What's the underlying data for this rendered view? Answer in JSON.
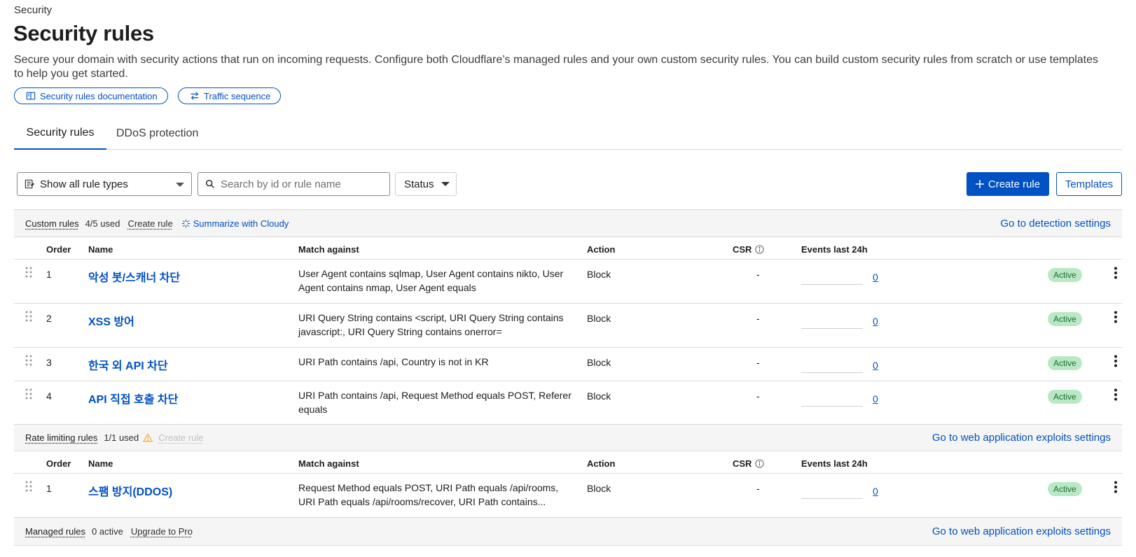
{
  "breadcrumb": "Security",
  "page_title": "Security rules",
  "description": "Secure your domain with security actions that run on incoming requests. Configure both Cloudflare’s managed rules and your own custom security rules. You can build custom security rules from scratch or use templates to help you get started.",
  "doc_links": [
    {
      "label": "Security rules documentation",
      "icon": "book-icon"
    },
    {
      "label": "Traffic sequence",
      "icon": "arrows-exchange-icon"
    }
  ],
  "tabs": [
    {
      "label": "Security rules",
      "active": true
    },
    {
      "label": "DDoS protection",
      "active": false
    }
  ],
  "toolbar": {
    "rule_type_select": "Show all rule types",
    "search_placeholder": "Search by id or rule name",
    "status_label": "Status",
    "create_label": "Create rule",
    "templates_label": "Templates"
  },
  "columns": {
    "order": "Order",
    "name": "Name",
    "match": "Match against",
    "action": "Action",
    "csr": "CSR",
    "events": "Events last 24h"
  },
  "custom_section": {
    "label": "Custom rules",
    "used": "4/5 used",
    "create_link": "Create rule",
    "cloudy_link": "Summarize with Cloudy",
    "right_link": "Go to detection settings"
  },
  "custom_rules": [
    {
      "order": "1",
      "name": "악성 봇/스캐너 차단",
      "match": "User Agent contains sqlmap, User Agent contains nikto, User Agent contains nmap, User Agent equals",
      "action": "Block",
      "csr": "-",
      "events": "0",
      "status": "Active"
    },
    {
      "order": "2",
      "name": "XSS 방어",
      "match": "URI Query String contains <script, URI Query String contains javascript:, URI Query String contains onerror=",
      "action": "Block",
      "csr": "-",
      "events": "0",
      "status": "Active"
    },
    {
      "order": "3",
      "name": "한국 외 API 차단",
      "match": "URI Path contains /api, Country is not in KR",
      "action": "Block",
      "csr": "-",
      "events": "0",
      "status": "Active"
    },
    {
      "order": "4",
      "name": "API 직접 호출 차단",
      "match": "URI Path contains /api, Request Method equals POST, Referer equals",
      "action": "Block",
      "csr": "-",
      "events": "0",
      "status": "Active"
    }
  ],
  "rate_section": {
    "label": "Rate limiting rules",
    "used": "1/1 used",
    "create_link": "Create rule",
    "right_link": "Go to web application exploits settings"
  },
  "rate_rules": [
    {
      "order": "1",
      "name": "스팸 방지(DDOS)",
      "match": "Request Method equals POST, URI Path equals /api/rooms, URI Path equals /api/rooms/recover, URI Path contains...",
      "action": "Block",
      "csr": "-",
      "events": "0",
      "status": "Active"
    }
  ],
  "managed_section": {
    "label": "Managed rules",
    "used": "0 active",
    "upgrade_link": "Upgrade to Pro",
    "right_link": "Go to web application exploits settings"
  },
  "colors": {
    "accent": "#0051c3",
    "active_badge_bg": "#b8e9c4",
    "active_badge_text": "#1f6b32",
    "warning": "#f6b026"
  }
}
